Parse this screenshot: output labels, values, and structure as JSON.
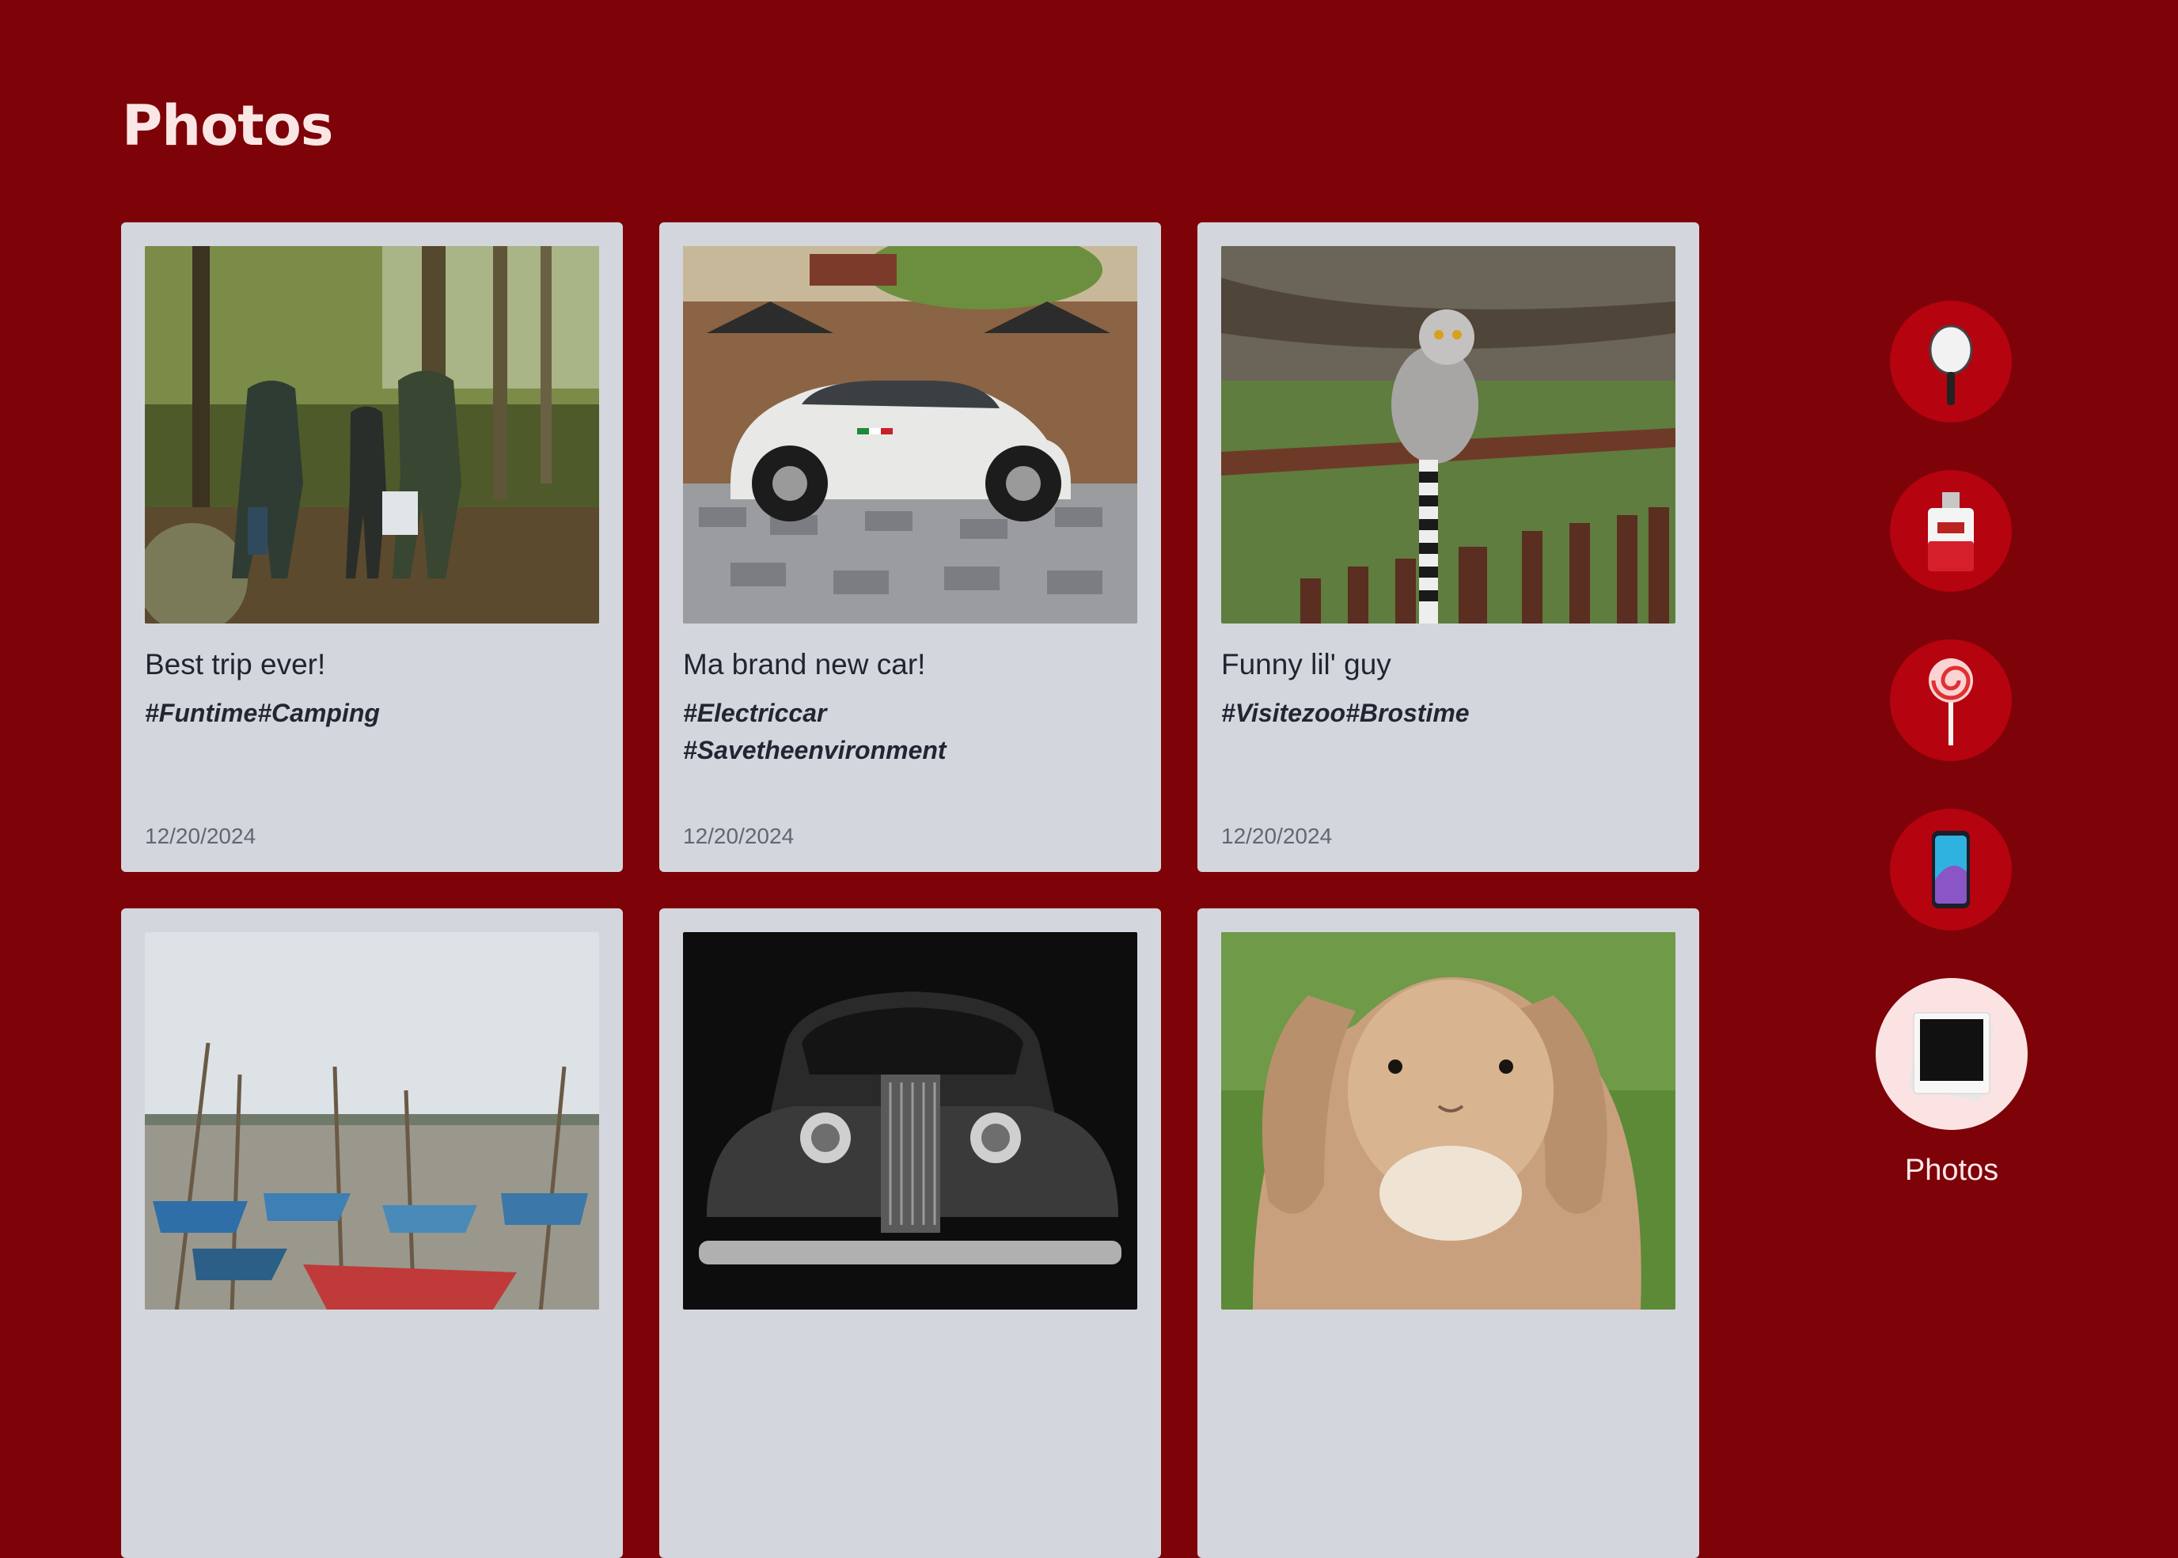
{
  "page": {
    "title": "Photos"
  },
  "cards": [
    {
      "caption": "Best trip ever!",
      "tags": "#Funtime#Camping",
      "date": "12/20/2024",
      "image": "hikers-forest"
    },
    {
      "caption": "Ma brand new car!",
      "tags": "#Electriccar\n#Savetheenvironment",
      "date": "12/20/2024",
      "image": "white-fiat"
    },
    {
      "caption": "Funny lil' guy",
      "tags": "#Visitezoo#Brostime",
      "date": "12/20/2024",
      "image": "lemur-on-fence"
    },
    {
      "caption": "",
      "tags": "",
      "date": "",
      "image": "harbor-boats"
    },
    {
      "caption": "",
      "tags": "",
      "date": "",
      "image": "vintage-car-bw"
    },
    {
      "caption": "",
      "tags": "",
      "date": "",
      "image": "bunny"
    }
  ],
  "dock": {
    "items": [
      {
        "name": "mirror-icon"
      },
      {
        "name": "perfume-icon"
      },
      {
        "name": "lollipop-icon"
      },
      {
        "name": "phone-icon"
      },
      {
        "name": "photos-icon",
        "label": "Photos",
        "active": true
      }
    ]
  },
  "colors": {
    "background": "#7d0309",
    "card": "#d4d6dd",
    "dock_button": "#b5030f",
    "dock_active": "#fbe3e3"
  }
}
